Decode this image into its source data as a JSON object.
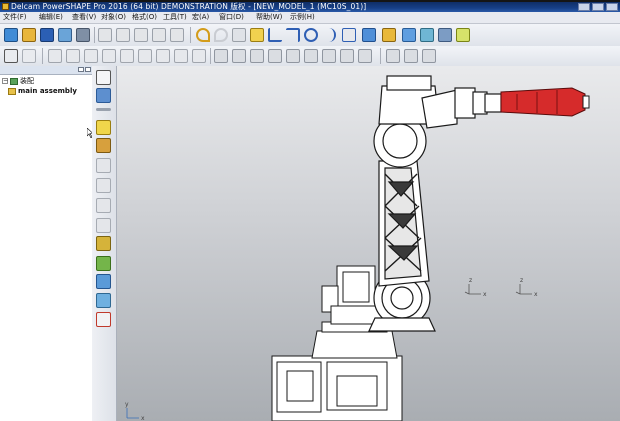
{
  "window": {
    "title": "Delcam PowerSHAPE Pro 2016 (64 bit) DEMONSTRATION 版权 - [NEW_MODEL_1 (MC10S_01)]"
  },
  "menu": {
    "items": [
      "文件(F)",
      "编辑(E)",
      "查看(V)",
      "对象(O)",
      "格式(O)",
      "工具(T)",
      "宏(A)",
      "窗口(D)",
      "帮助(W)",
      "示例(H)"
    ]
  },
  "tree": {
    "root_label": "装配",
    "assembly_label": "main assembly"
  },
  "viewport": {
    "workplane_1": {
      "x": "x",
      "y": "y",
      "z": "z"
    },
    "workplane_2": {
      "x": "x",
      "y": "y",
      "z": "z"
    },
    "origin_axes": {
      "x": "x",
      "y": "y"
    }
  },
  "colors": {
    "title_bar": "#173f86",
    "highlight_part": "#d62b2b"
  }
}
